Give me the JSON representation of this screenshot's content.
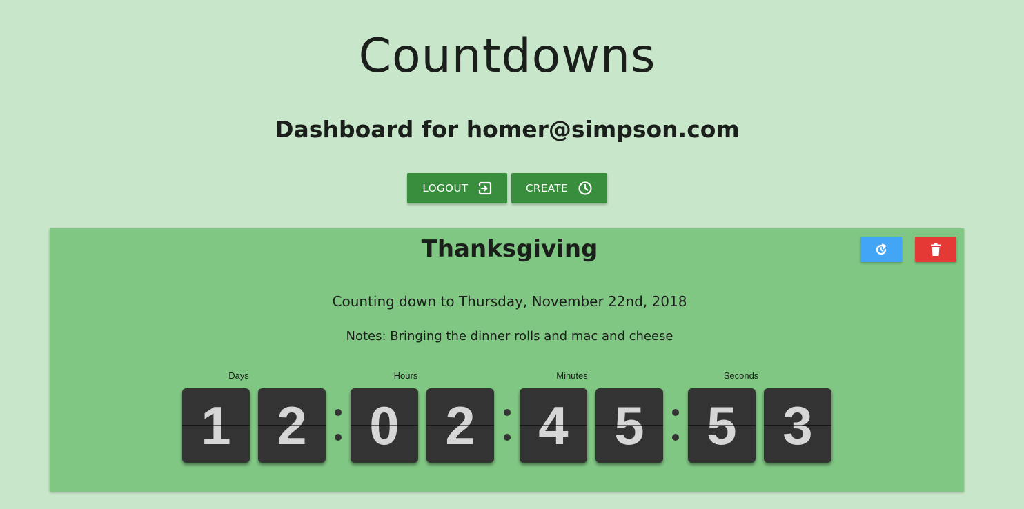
{
  "app": {
    "title": "Countdowns",
    "dashboard_heading": "Dashboard for homer@simpson.com"
  },
  "actions": {
    "logout_label": "LOGOUT",
    "logout_icon": "logout-icon",
    "create_label": "CREATE",
    "create_icon": "clock-icon"
  },
  "countdown": {
    "title": "Thanksgiving",
    "target_text": "Counting down to Thursday, November 22nd, 2018",
    "notes_text": "Notes: Bringing the dinner rolls and mac and cheese",
    "reset_icon": "reset-icon",
    "delete_icon": "trash-icon",
    "units": [
      {
        "label": "Days",
        "digits": [
          "1",
          "2"
        ]
      },
      {
        "label": "Hours",
        "digits": [
          "0",
          "2"
        ]
      },
      {
        "label": "Minutes",
        "digits": [
          "4",
          "5"
        ]
      },
      {
        "label": "Seconds",
        "digits": [
          "5",
          "3"
        ]
      }
    ]
  },
  "colors": {
    "page_background": "#c8e6c9",
    "card_background": "#81c784",
    "primary_button": "#388e3c",
    "reset_button": "#42a5f5",
    "delete_button": "#e53935",
    "digit_tile": "#333333",
    "digit_text": "#d6d6d6"
  }
}
